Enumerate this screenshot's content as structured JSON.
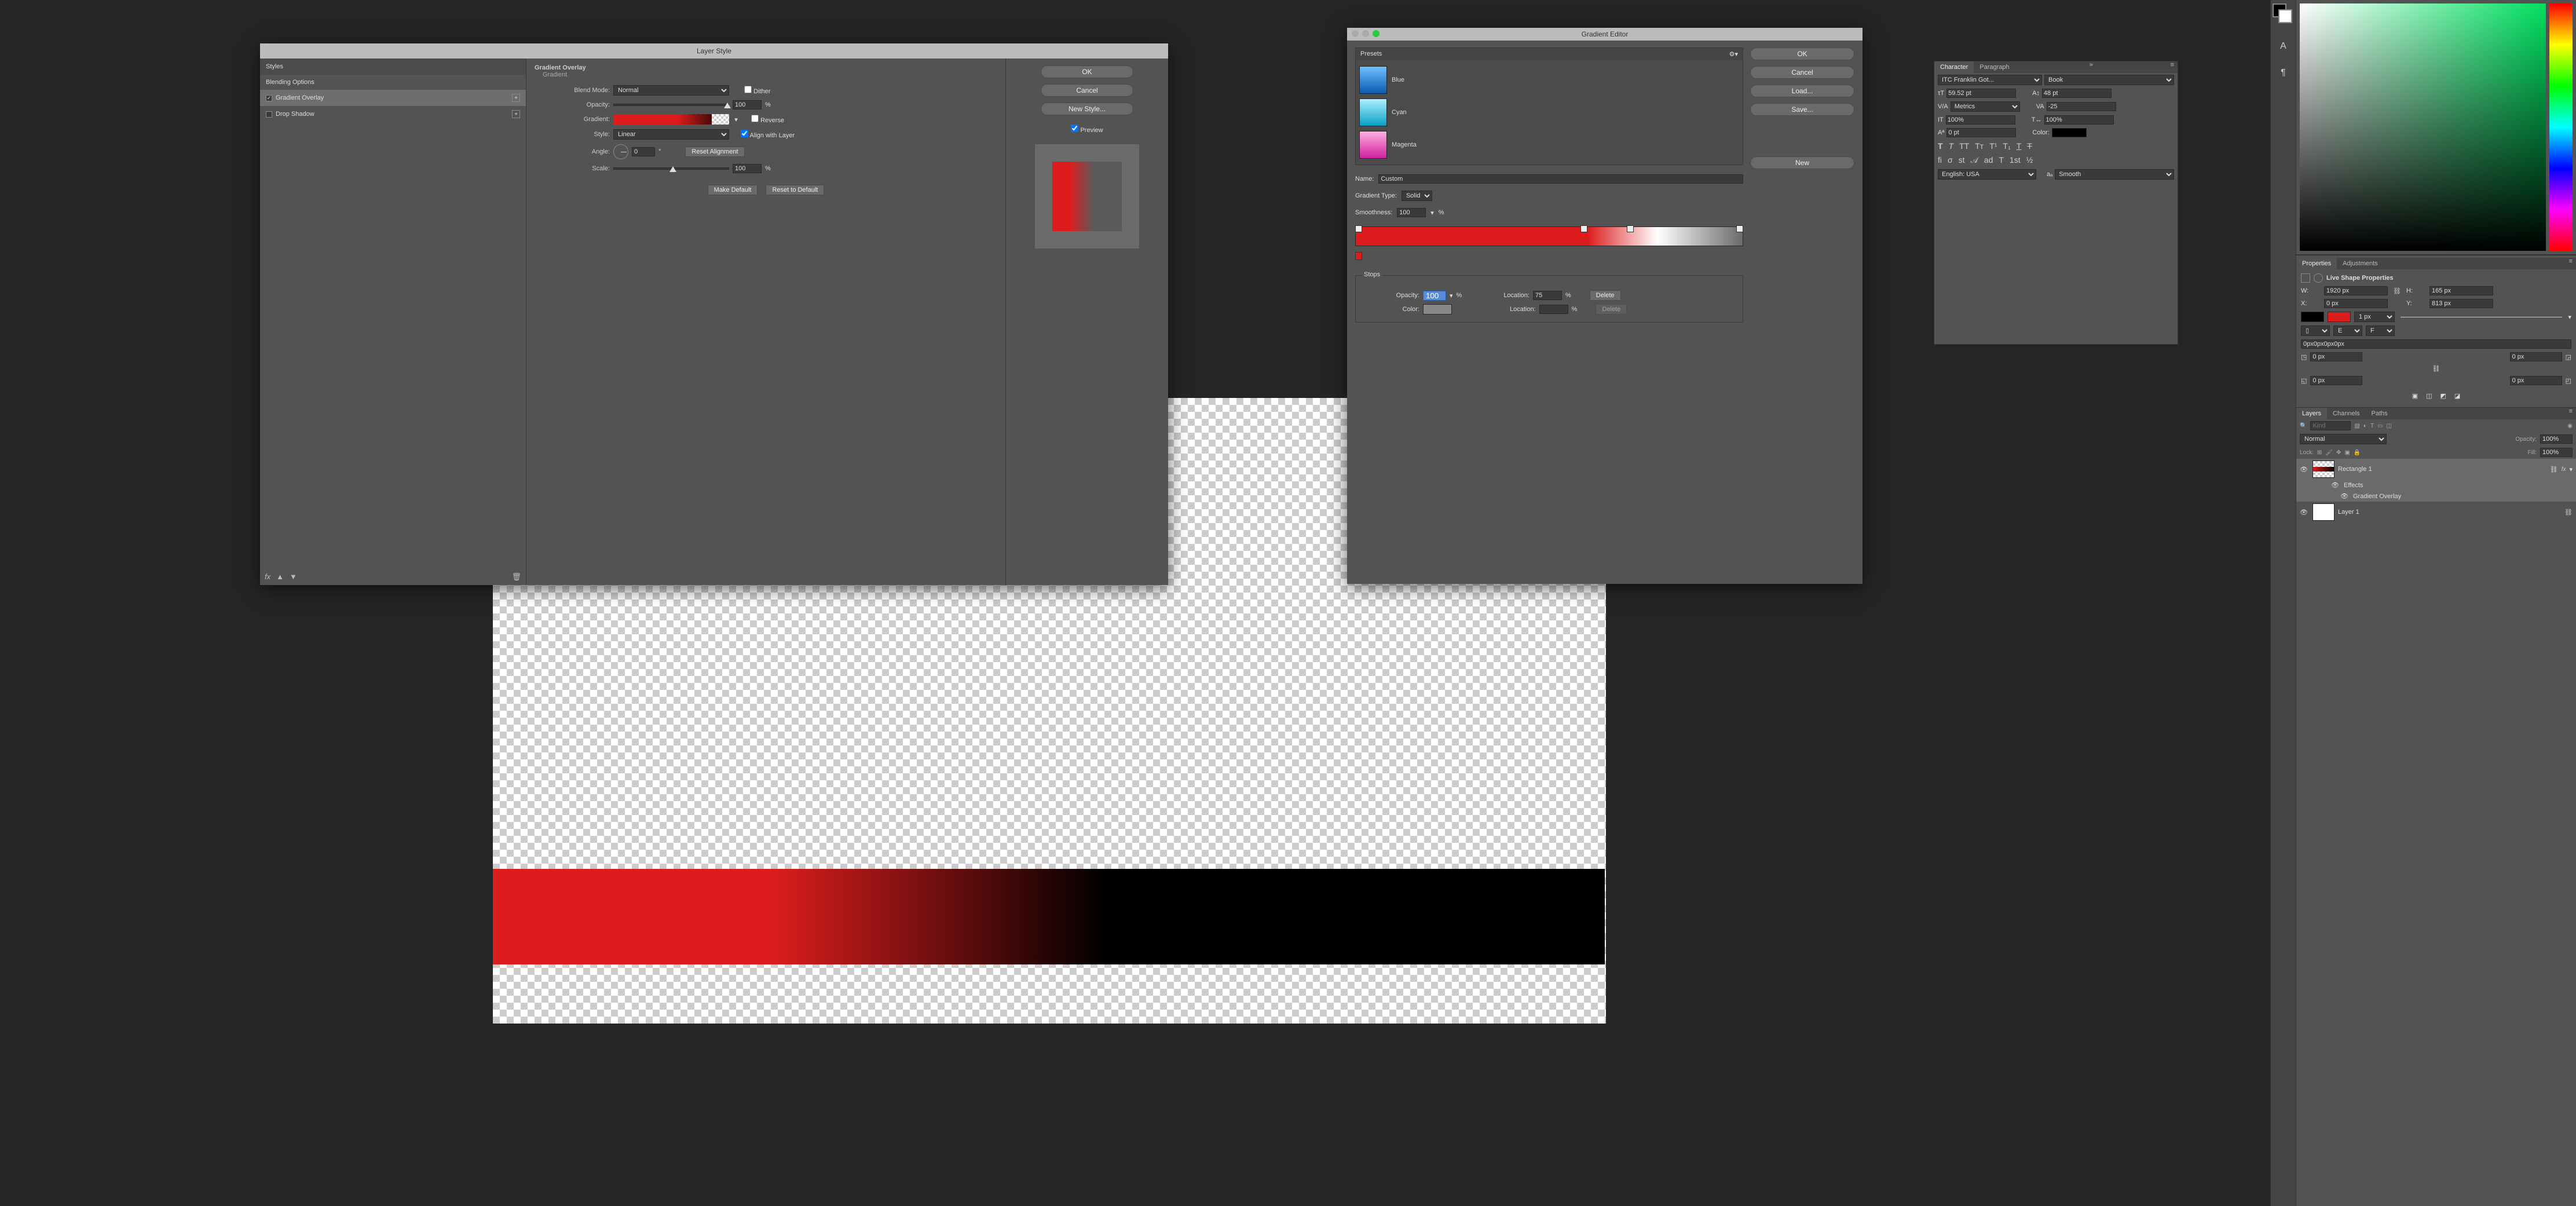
{
  "layerStyle": {
    "title": "Layer Style",
    "sections": {
      "main": "Gradient Overlay",
      "sub": "Gradient"
    },
    "stylesList": {
      "header": "Styles",
      "blendingOptions": "Blending Options",
      "gradientOverlay": "Gradient Overlay",
      "dropShadow": "Drop Shadow"
    },
    "fields": {
      "blendMode_label": "Blend Mode:",
      "blendMode_value": "Normal",
      "dither_label": "Dither",
      "opacity_label": "Opacity:",
      "opacity_value": "100",
      "percent": "%",
      "gradient_label": "Gradient:",
      "reverse_label": "Reverse",
      "style_label": "Style:",
      "style_value": "Linear",
      "align_label": "Align with Layer",
      "angle_label": "Angle:",
      "angle_value": "0",
      "degree": "°",
      "reset_align": "Reset Alignment",
      "scale_label": "Scale:",
      "scale_value": "100",
      "make_default": "Make Default",
      "reset_default": "Reset to Default"
    },
    "buttons": {
      "ok": "OK",
      "cancel": "Cancel",
      "newStyle": "New Style...",
      "preview": "Preview"
    },
    "preview_checked": true
  },
  "gradientEditor": {
    "title": "Gradient Editor",
    "presetsHeader": "Presets",
    "presets": [
      {
        "name": "Blue",
        "css": "linear-gradient(#6ec1ff,#0a5ab4)"
      },
      {
        "name": "Cyan",
        "css": "linear-gradient(#aef0ff,#0aa0c4)"
      },
      {
        "name": "Magenta",
        "css": "linear-gradient(#ffb0e0,#d020a0)"
      }
    ],
    "buttons": {
      "ok": "OK",
      "cancel": "Cancel",
      "load": "Load...",
      "save": "Save...",
      "new": "New",
      "delete": "Delete"
    },
    "name_label": "Name:",
    "name_value": "Custom",
    "type_label": "Gradient Type:",
    "type_value": "Solid",
    "smooth_label": "Smoothness:",
    "smooth_value": "100",
    "percent": "%",
    "stops_label": "Stops",
    "opacity_label": "Opacity:",
    "opacity_value": "100",
    "location_label": "Location:",
    "location_value": "75",
    "color_label": "Color:"
  },
  "character": {
    "tabChar": "Character",
    "tabPara": "Paragraph",
    "fontFamily": "ITC Franklin Got...",
    "fontStyle": "Book",
    "size": "59.52 pt",
    "leading": "48 pt",
    "kerning": "Metrics",
    "tracking": "-25",
    "vscale": "100%",
    "hscale": "100%",
    "baseline": "0 pt",
    "colorLabel": "Color:",
    "lang": "English: USA",
    "aa": "Smooth"
  },
  "properties": {
    "tabProps": "Properties",
    "tabAdj": "Adjustments",
    "title": "Live Shape Properties",
    "W_label": "W:",
    "W": "1920 px",
    "H_label": "H:",
    "H": "165 px",
    "X_label": "X:",
    "X": "0 px",
    "Y_label": "Y:",
    "Y": "813 px",
    "stroke": "1 px",
    "corners": "0px0px0px0px",
    "zero": "0 px"
  },
  "layers": {
    "tabs": {
      "layers": "Layers",
      "channels": "Channels",
      "paths": "Paths"
    },
    "kind_placeholder": "Kind",
    "blend": "Normal",
    "opacity_label": "Opacity:",
    "opacity_value": "100%",
    "lock_label": "Lock:",
    "fill_label": "Fill:",
    "fill_value": "100%",
    "rectangle": "Rectangle 1",
    "effects": "Effects",
    "gradOverlay": "Gradient Overlay",
    "layer1": "Layer 1",
    "fx": "fx"
  }
}
